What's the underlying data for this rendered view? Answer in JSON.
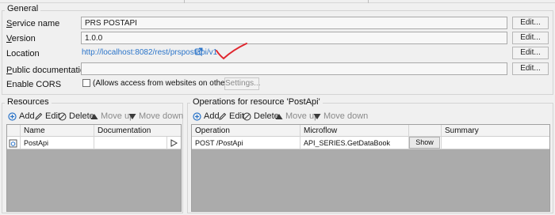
{
  "general": {
    "title": "General",
    "service_name_label": "Service name",
    "service_name_value": "PRS POSTAPI",
    "version_label": "Version",
    "version_value": "1.0.0",
    "location_label": "Location",
    "location_url": "http://localhost:8082/rest/prspostapi/v1",
    "public_doc_label": "Public documentation",
    "public_doc_value": "",
    "cors_label": "Enable CORS",
    "cors_checkbox_label": "(Allows access from websites on other servers)",
    "cors_checked": false,
    "settings_button": "Settings...",
    "edit_button": "Edit..."
  },
  "resources": {
    "title": "Resources",
    "toolbar": {
      "add": "Add",
      "edit": "Edit",
      "delete": "Delete",
      "move_up": "Move up",
      "move_down": "Move down"
    },
    "columns": [
      "Name",
      "Documentation"
    ],
    "rows": [
      {
        "name": "PostApi",
        "documentation": ""
      }
    ]
  },
  "operations": {
    "title": "Operations for resource 'PostApi'",
    "toolbar": {
      "add": "Add",
      "edit": "Edit",
      "delete": "Delete",
      "move_up": "Move up",
      "move_down": "Move down"
    },
    "columns": [
      "Operation",
      "Microflow",
      "",
      "Summary"
    ],
    "rows": [
      {
        "operation": "POST /PostApi",
        "microflow": "API_SERIES.GetDataBook",
        "show_button": "Show",
        "summary": ""
      }
    ]
  },
  "colors": {
    "link": "#2a74c9",
    "annotation": "#e0262e",
    "grid_empty": "#ababab",
    "add_icon": "#2a74c9"
  }
}
